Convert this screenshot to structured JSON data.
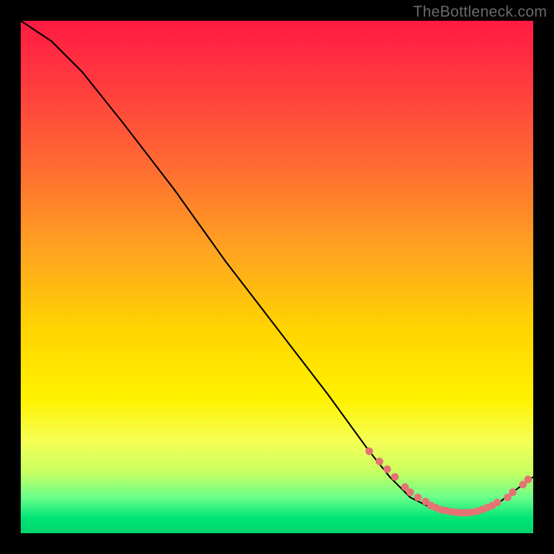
{
  "watermark": "TheBottleneck.com",
  "chart_data": {
    "type": "line",
    "title": "",
    "xlabel": "",
    "ylabel": "",
    "xlim": [
      0,
      100
    ],
    "ylim": [
      0,
      100
    ],
    "grid": false,
    "legend": false,
    "x": [
      0,
      6,
      12,
      20,
      30,
      40,
      50,
      60,
      68,
      72,
      76,
      80,
      84,
      88,
      92,
      96,
      100
    ],
    "values": [
      100,
      96,
      90,
      80,
      67,
      53,
      40,
      27,
      16,
      11,
      7,
      5,
      4,
      4,
      5,
      8,
      11
    ],
    "markers_x": [
      68,
      70,
      71.5,
      73,
      75,
      76,
      77.5,
      79,
      80,
      81,
      82,
      83,
      84,
      85,
      86,
      87,
      88,
      89,
      90,
      91,
      92,
      93,
      95,
      96,
      98,
      99
    ],
    "markers_y": [
      16,
      14,
      12.5,
      11,
      9,
      8,
      7,
      6.2,
      5.4,
      5,
      4.6,
      4.4,
      4.2,
      4.1,
      4,
      4,
      4.1,
      4.3,
      4.6,
      5,
      5.4,
      6,
      7,
      8,
      9.5,
      10.5
    ],
    "marker_color": "#e57373",
    "line_color": "#000000"
  }
}
